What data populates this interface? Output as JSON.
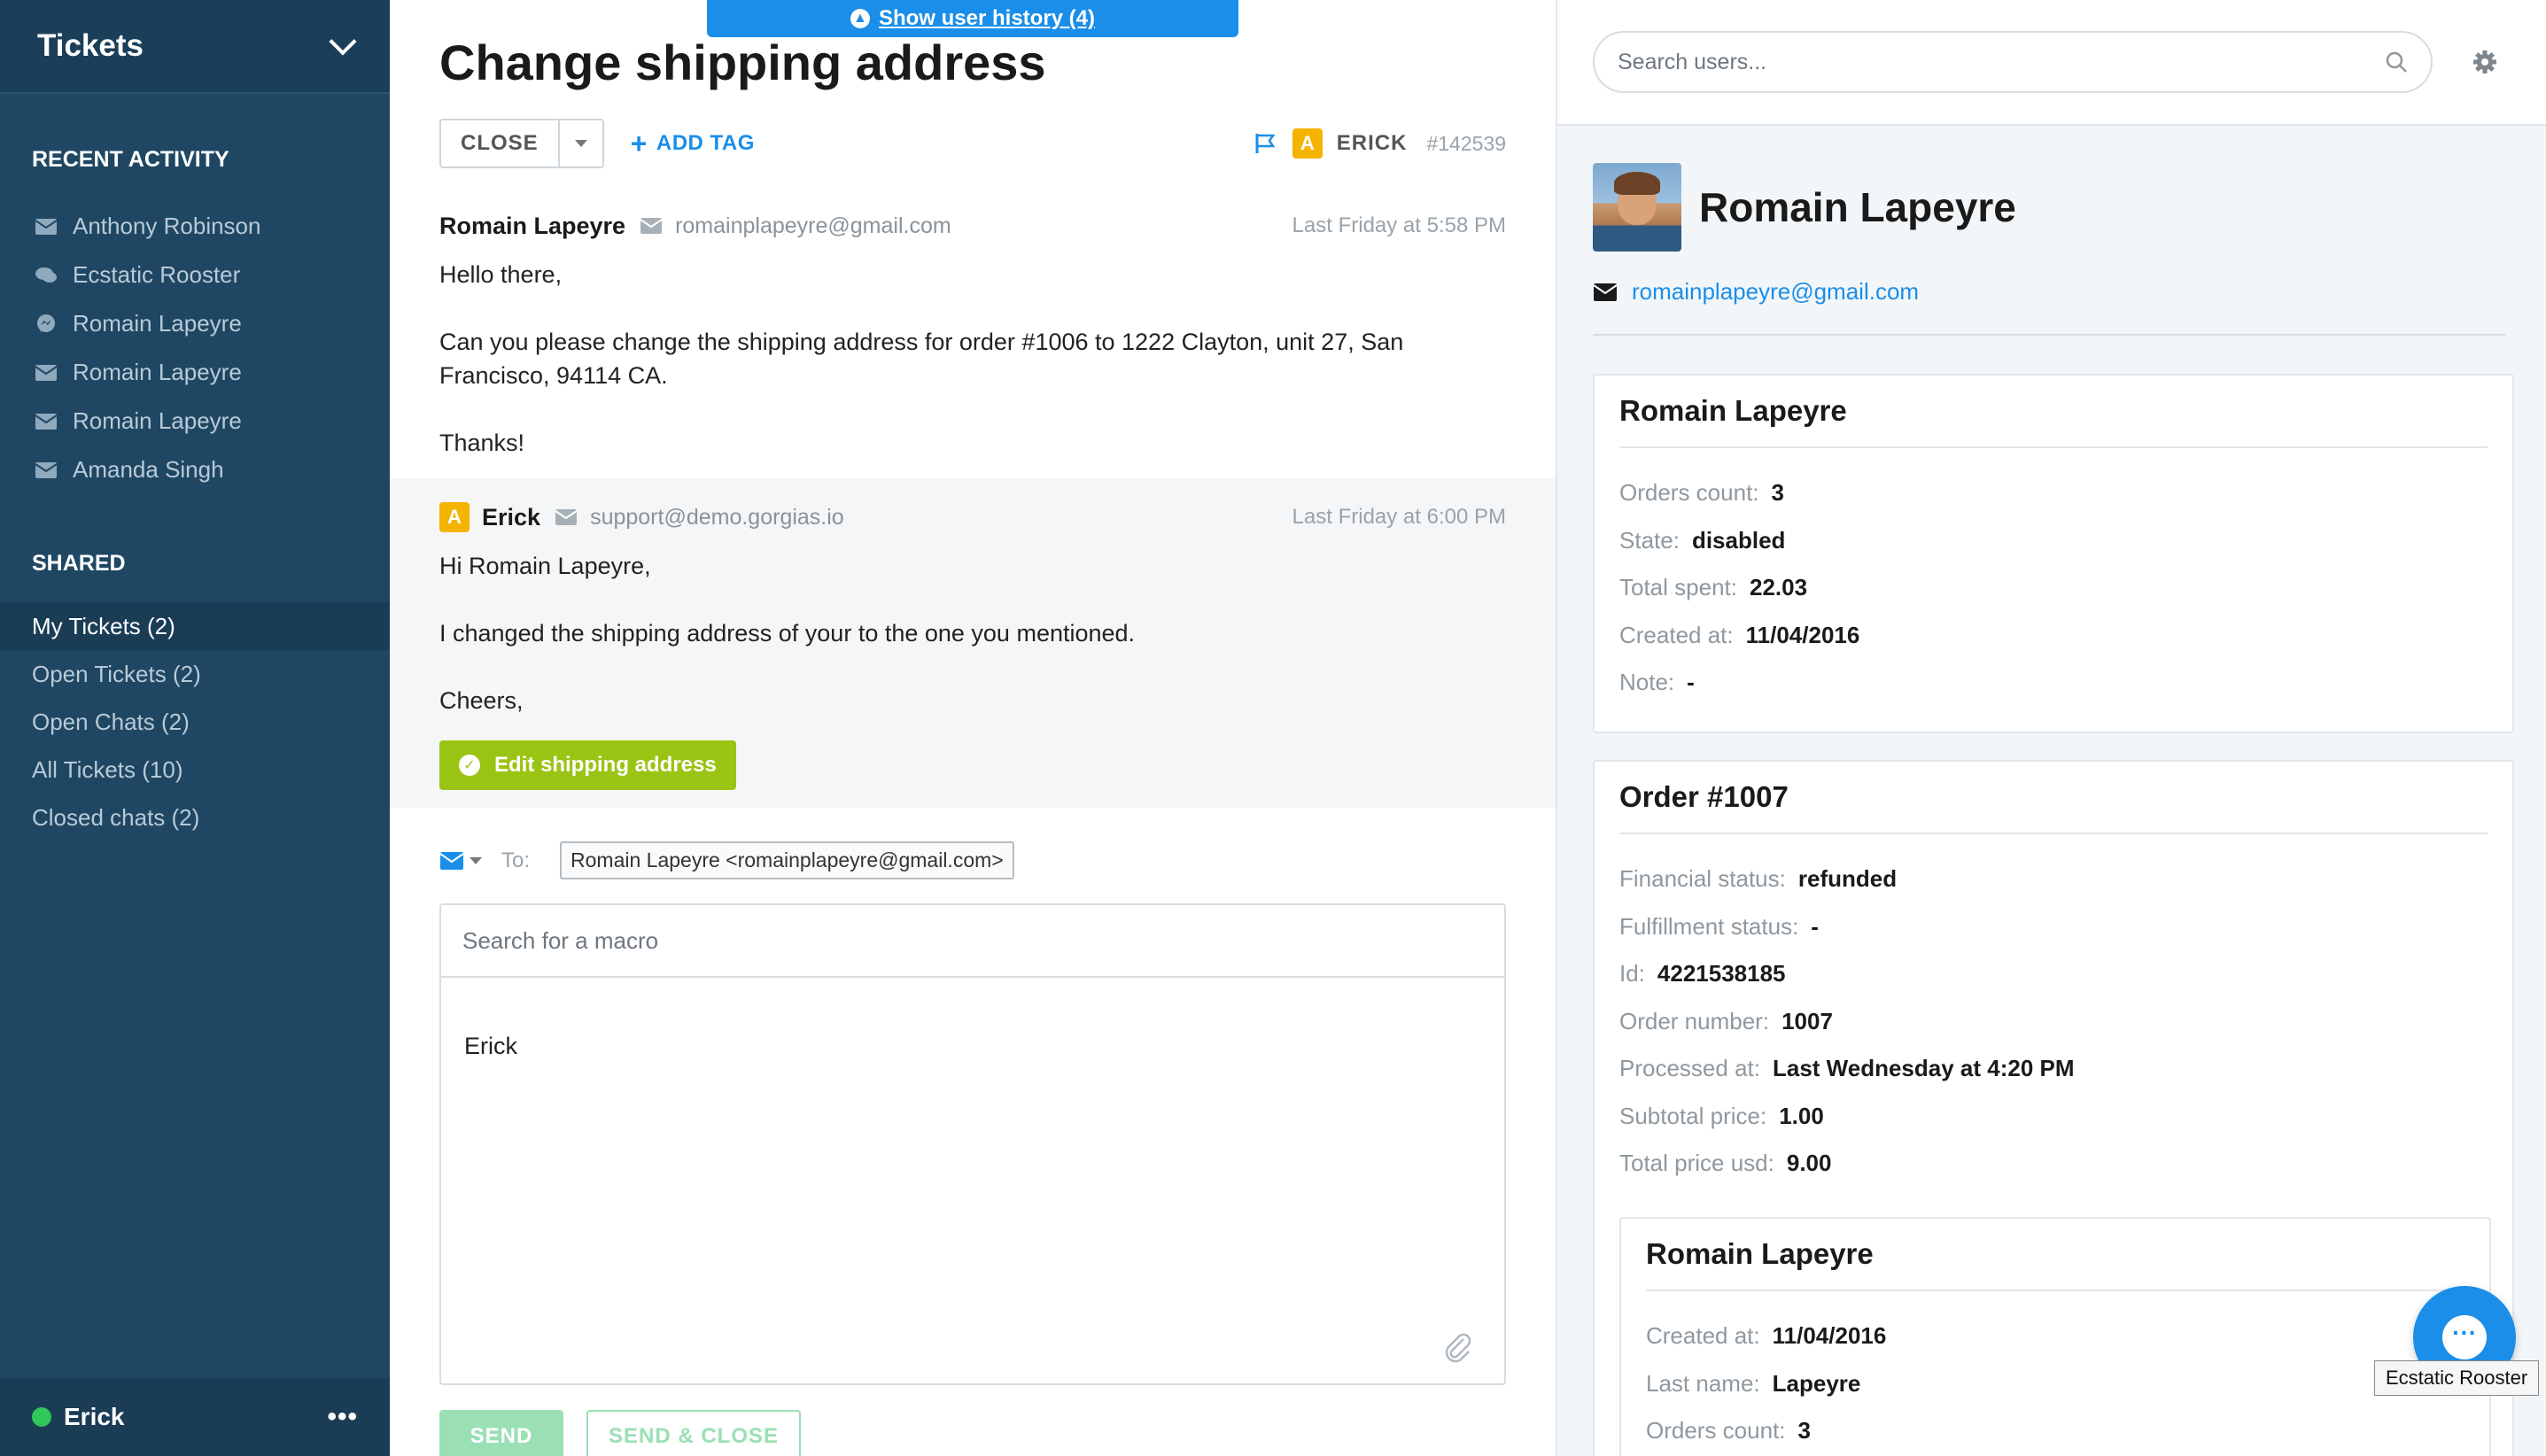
{
  "sidebar": {
    "title": "Tickets",
    "recent_title": "RECENT ACTIVITY",
    "recent": [
      {
        "label": "Anthony Robinson",
        "icon": "envelope-icon"
      },
      {
        "label": "Ecstatic Rooster",
        "icon": "chat-icon"
      },
      {
        "label": "Romain Lapeyre",
        "icon": "messenger-icon"
      },
      {
        "label": "Romain Lapeyre",
        "icon": "envelope-icon"
      },
      {
        "label": "Romain Lapeyre",
        "icon": "envelope-icon"
      },
      {
        "label": "Amanda Singh",
        "icon": "envelope-icon"
      }
    ],
    "shared_title": "SHARED",
    "views": [
      {
        "label": "My Tickets (2)",
        "active": true
      },
      {
        "label": "Open Tickets (2)"
      },
      {
        "label": "Open Chats (2)"
      },
      {
        "label": "All Tickets (10)"
      },
      {
        "label": "Closed chats (2)"
      }
    ],
    "footer_user": "Erick",
    "footer_more": "•••",
    "status_color": "#31c759"
  },
  "main": {
    "history_banner": "Show user history (4)",
    "title": "Change shipping address",
    "close_label": "CLOSE",
    "add_tag_label": "ADD TAG",
    "agent_badge": "A",
    "agent_name": "ERICK",
    "ticket_id": "#142539",
    "messages": [
      {
        "sender": "Romain Lapeyre",
        "email": "romainplapeyre@gmail.com",
        "time": "Last Friday at 5:58 PM",
        "lines": [
          "Hello there,",
          "Can you please change the shipping address for order #1006 to 1222 Clayton, unit 27, San Francisco, 94114 CA.",
          "Thanks!"
        ]
      },
      {
        "badge": "A",
        "sender": "Erick",
        "email": "support@demo.gorgias.io",
        "time": "Last Friday at 6:00 PM",
        "lines": [
          "Hi Romain Lapeyre,",
          "I changed the shipping address of your to the one you mentioned.",
          "Cheers,"
        ],
        "action_label": "Edit shipping address"
      }
    ],
    "reply": {
      "to_label": "To:",
      "recipient": "Romain Lapeyre <romainplapeyre@gmail.com>",
      "macro_placeholder": "Search for a macro",
      "body": "Erick",
      "send_label": "SEND",
      "send_close_label": "SEND & CLOSE"
    }
  },
  "right": {
    "search_placeholder": "Search users...",
    "profile": {
      "name": "Romain Lapeyre",
      "email": "romainplapeyre@gmail.com"
    },
    "customer_card": {
      "title": "Romain Lapeyre",
      "fields": [
        {
          "k": "Orders count:",
          "v": "3"
        },
        {
          "k": "State:",
          "v": "disabled"
        },
        {
          "k": "Total spent:",
          "v": "22.03"
        },
        {
          "k": "Created at:",
          "v": "11/04/2016"
        },
        {
          "k": "Note:",
          "v": "-"
        }
      ]
    },
    "order_card": {
      "title": "Order #1007",
      "fields": [
        {
          "k": "Financial status:",
          "v": "refunded"
        },
        {
          "k": "Fulfillment status:",
          "v": "-"
        },
        {
          "k": "Id:",
          "v": "4221538185"
        },
        {
          "k": "Order number:",
          "v": "1007"
        },
        {
          "k": "Processed at:",
          "v": "Last Wednesday at 4:20 PM"
        },
        {
          "k": "Subtotal price:",
          "v": "1.00"
        },
        {
          "k": "Total price usd:",
          "v": "9.00"
        }
      ],
      "sub_card": {
        "title": "Romain Lapeyre",
        "fields": [
          {
            "k": "Created at:",
            "v": "11/04/2016"
          },
          {
            "k": "Last name:",
            "v": "Lapeyre"
          },
          {
            "k": "Orders count:",
            "v": "3"
          }
        ]
      }
    },
    "chat_tooltip": "Ecstatic Rooster"
  },
  "colors": {
    "sidebar_bg": "#1f4763",
    "accent_blue": "#1a8ee8",
    "action_green": "#9ac414",
    "agent_badge": "#f5b400",
    "send_green": "#9ae0b4"
  }
}
